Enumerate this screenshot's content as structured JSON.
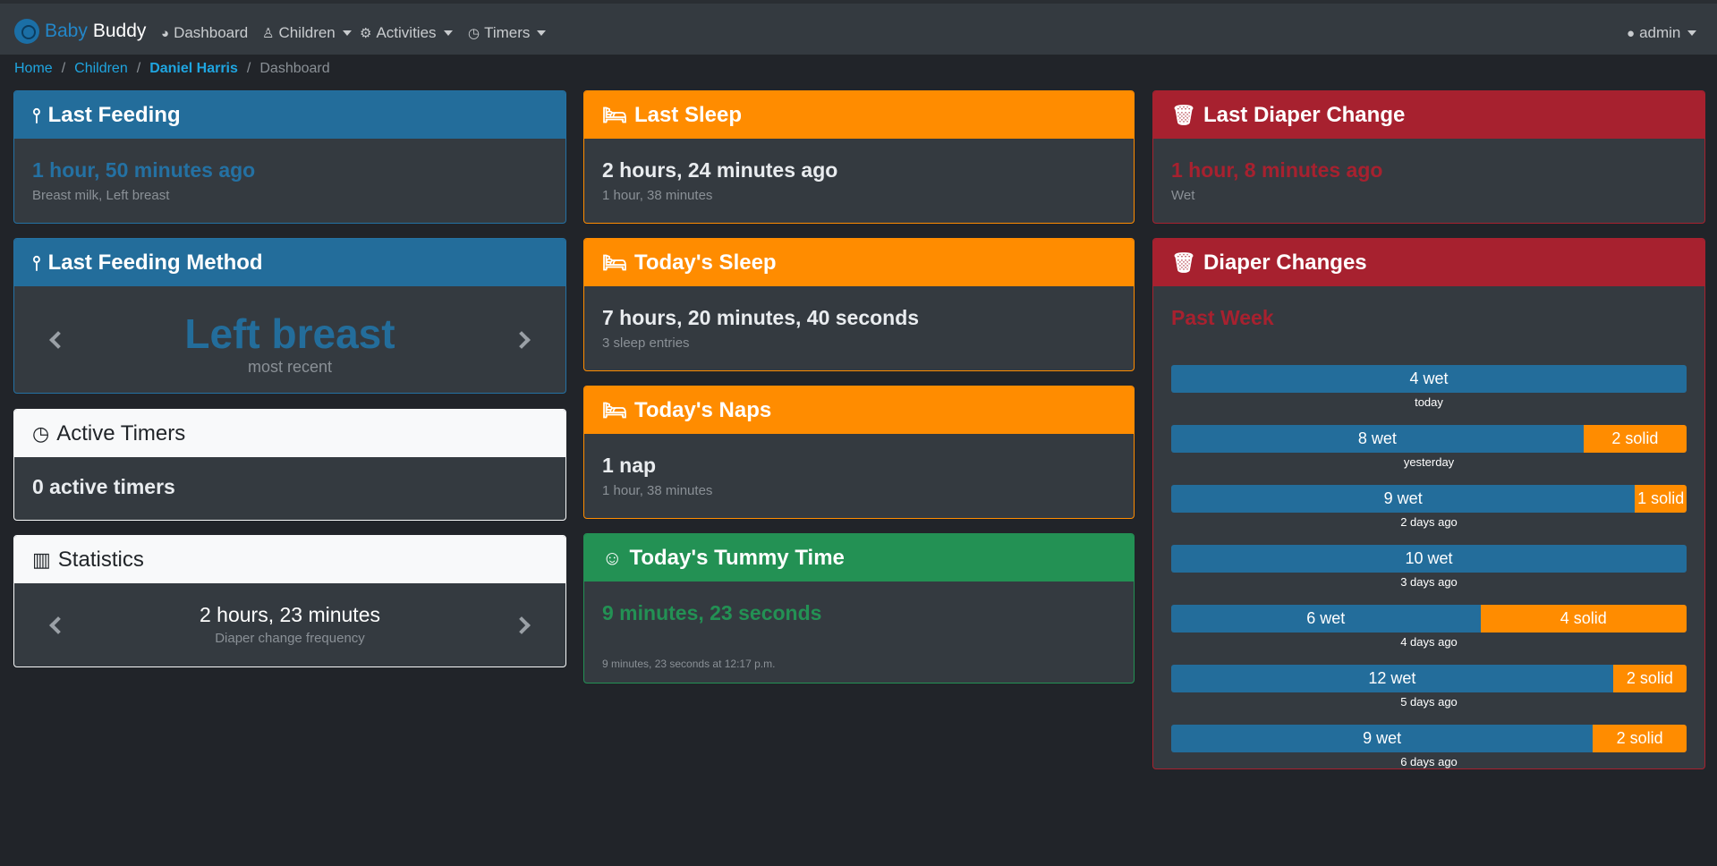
{
  "app": {
    "brand_first": "Baby",
    "brand_second": "Buddy"
  },
  "nav": {
    "dashboard": "Dashboard",
    "children": "Children",
    "activities": "Activities",
    "timers": "Timers",
    "user": "admin"
  },
  "breadcrumb": {
    "home": "Home",
    "children": "Children",
    "child": "Daniel Harris",
    "current": "Dashboard"
  },
  "cards": {
    "last_feeding": {
      "title": "Last Feeding",
      "value": "1 hour, 50 minutes ago",
      "detail": "Breast milk, Left breast"
    },
    "last_feeding_method": {
      "title": "Last Feeding Method",
      "value": "Left breast",
      "detail": "most recent"
    },
    "active_timers": {
      "title": "Active Timers",
      "value": "0 active timers"
    },
    "statistics": {
      "title": "Statistics",
      "value": "2 hours, 23 minutes",
      "detail": "Diaper change frequency"
    },
    "last_sleep": {
      "title": "Last Sleep",
      "value": "2 hours, 24 minutes ago",
      "detail": "1 hour, 38 minutes"
    },
    "todays_sleep": {
      "title": "Today's Sleep",
      "value": "7 hours, 20 minutes, 40 seconds",
      "detail": "3 sleep entries"
    },
    "todays_naps": {
      "title": "Today's Naps",
      "value": "1 nap",
      "detail": "1 hour, 38 minutes"
    },
    "tummy_time": {
      "title": "Today's Tummy Time",
      "value": "9 minutes, 23 seconds",
      "detail": "9 minutes, 23 seconds at 12:17 p.m."
    },
    "last_diaper_change": {
      "title": "Last Diaper Change",
      "value": "1 hour, 8 minutes ago",
      "detail": "Wet"
    },
    "diaper_changes": {
      "title": "Diaper Changes",
      "subtitle": "Past Week",
      "days": [
        {
          "label": "today",
          "wet": 4,
          "solid": 0,
          "wet_text": "4 wet",
          "solid_text": ""
        },
        {
          "label": "yesterday",
          "wet": 8,
          "solid": 2,
          "wet_text": "8 wet",
          "solid_text": "2 solid"
        },
        {
          "label": "2 days ago",
          "wet": 9,
          "solid": 1,
          "wet_text": "9 wet",
          "solid_text": "1 solid"
        },
        {
          "label": "3 days ago",
          "wet": 10,
          "solid": 0,
          "wet_text": "10 wet",
          "solid_text": ""
        },
        {
          "label": "4 days ago",
          "wet": 6,
          "solid": 4,
          "wet_text": "6 wet",
          "solid_text": "4 solid"
        },
        {
          "label": "5 days ago",
          "wet": 12,
          "solid": 2,
          "wet_text": "12 wet",
          "solid_text": "2 solid"
        },
        {
          "label": "6 days ago",
          "wet": 9,
          "solid": 2,
          "wet_text": "9 wet",
          "solid_text": "2 solid"
        }
      ]
    }
  },
  "colors": {
    "primary": "#236d9b",
    "warning": "#ff8c00",
    "danger": "#a7212f",
    "success": "#239154"
  },
  "icons": {
    "brand": "baby-buddy-logo-icon",
    "dashboard": "dashboard-icon",
    "children": "child-icon",
    "activities": "activities-icon",
    "timers": "clock-icon",
    "user": "user-icon",
    "feeding": "spoon-icon",
    "sleep": "bed-icon",
    "diaper": "trash-icon",
    "tummy": "smile-icon",
    "stats": "bar-chart-icon"
  }
}
